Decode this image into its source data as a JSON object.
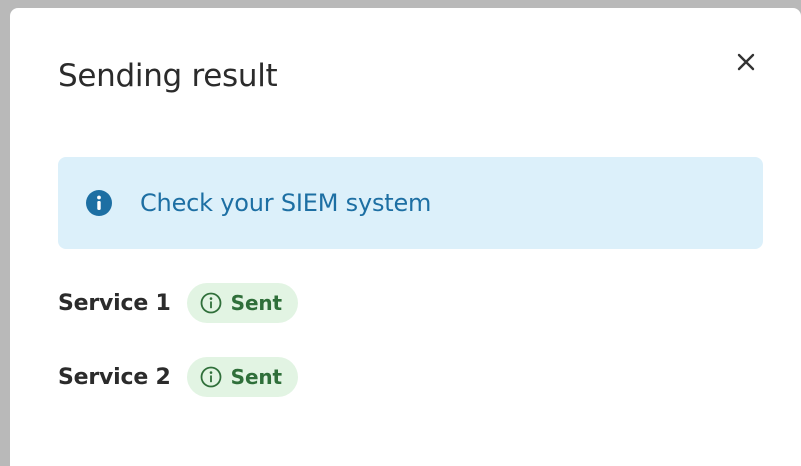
{
  "dialog": {
    "title": "Sending result",
    "close_icon": "close-icon"
  },
  "alert": {
    "icon": "info-circle-filled-icon",
    "message": "Check your SIEM system",
    "colors": {
      "background": "#dcf0fa",
      "text": "#1d6fa3"
    }
  },
  "services": [
    {
      "name": "Service 1",
      "status": "Sent",
      "status_icon": "info-circle-outline-icon"
    },
    {
      "name": "Service 2",
      "status": "Sent",
      "status_icon": "info-circle-outline-icon"
    }
  ],
  "colors": {
    "status_badge_background": "#e2f4e3",
    "status_badge_text": "#2f6f3a"
  }
}
